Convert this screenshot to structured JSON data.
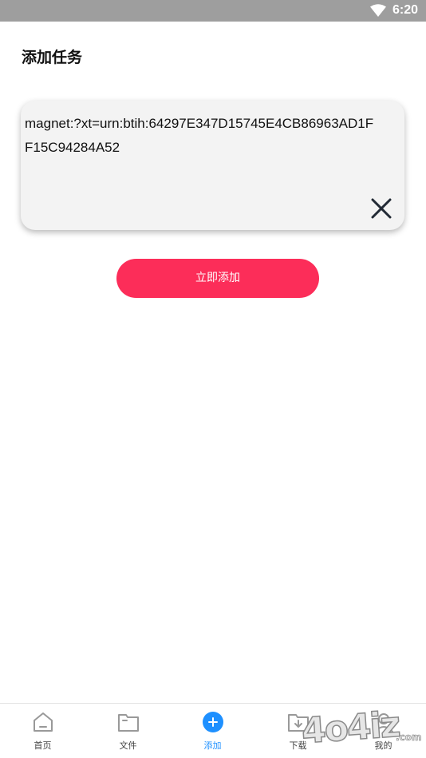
{
  "status_bar": {
    "time": "6:20",
    "wifi_icon": "wifi-icon"
  },
  "header": {
    "title": "添加任务"
  },
  "task_input": {
    "value": "magnet:?xt=urn:btih:64297E347D15745E4CB86963AD1FF15C94284A52",
    "clear_icon": "close-icon"
  },
  "add_button": {
    "label": "立即添加",
    "color": "#fc2d59"
  },
  "bottom_nav": {
    "active_color": "#1e90ff",
    "items": [
      {
        "label": "首页",
        "icon": "home-icon"
      },
      {
        "label": "文件",
        "icon": "folder-icon"
      },
      {
        "label": "添加",
        "icon": "add-icon"
      },
      {
        "label": "下载",
        "icon": "download-folder-icon"
      },
      {
        "label": "我的",
        "icon": "profile-icon"
      }
    ]
  },
  "watermark": {
    "text": "4o4iz",
    "suffix": ".com"
  }
}
